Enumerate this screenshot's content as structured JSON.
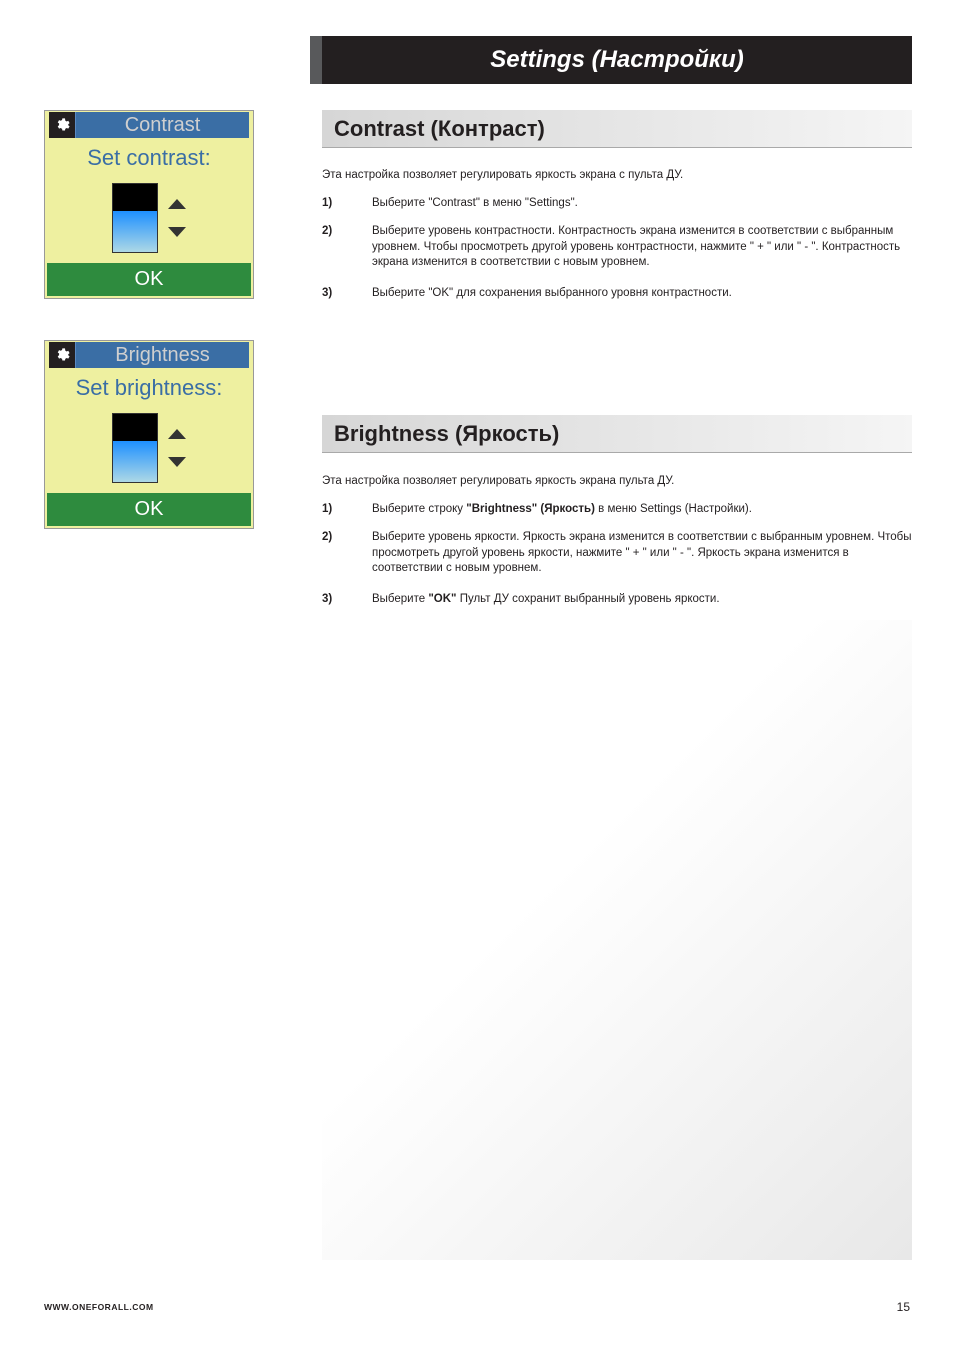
{
  "header": {
    "title": "Settings (Настройки)"
  },
  "widgets": {
    "contrast": {
      "title": "Contrast",
      "subtitle": "Set contrast:",
      "ok": "OK"
    },
    "brightness": {
      "title": "Brightness",
      "subtitle": "Set brightness:",
      "ok": "OK"
    }
  },
  "sections": {
    "contrast": {
      "heading": "Contrast (Контраст)",
      "intro": "Эта настройка позволяет регулировать яркость экрана с пульта ДУ.",
      "steps": [
        {
          "num": "1)",
          "text": "Выберите \"Contrast\" в меню \"Settings\"."
        },
        {
          "num": "2)",
          "text": "Выберите уровень контрастности. Контрастность экрана изменится в соответствии с выбранным уровнем. Чтобы просмотреть другой уровень контрастности, нажмите \" + \" или \" - \". Контрастность экрана изменится в соответствии с новым уровнем."
        },
        {
          "num": "3)",
          "text": "Выберите \"OK\" для сохранения выбранного уровня контрастности."
        }
      ]
    },
    "brightness": {
      "heading": "Brightness (Яркость)",
      "intro": "Эта настройка позволяет регулировать яркость экрана пульта ДУ.",
      "steps": [
        {
          "num": "1)",
          "pre": "Выберите строку ",
          "bold": "\"Brightness\" (Яркость)",
          "post": " в меню Settings (Настройки)."
        },
        {
          "num": "2)",
          "text": "Выберите уровень яркости. Яркость экрана изменится в соответствии с выбранным уровнем. Чтобы просмотреть другой уровень яркости, нажмите \" + \" или \" - \". Яркость экрана изменится в соответствии с новым уровнем."
        },
        {
          "num": "3)",
          "pre": "Выберите ",
          "bold": "\"OK\"",
          "post": " Пульт ДУ сохранит выбранный уровень яркости."
        }
      ]
    }
  },
  "footer": {
    "url": "WWW.ONEFORALL.COM",
    "page": "15"
  }
}
